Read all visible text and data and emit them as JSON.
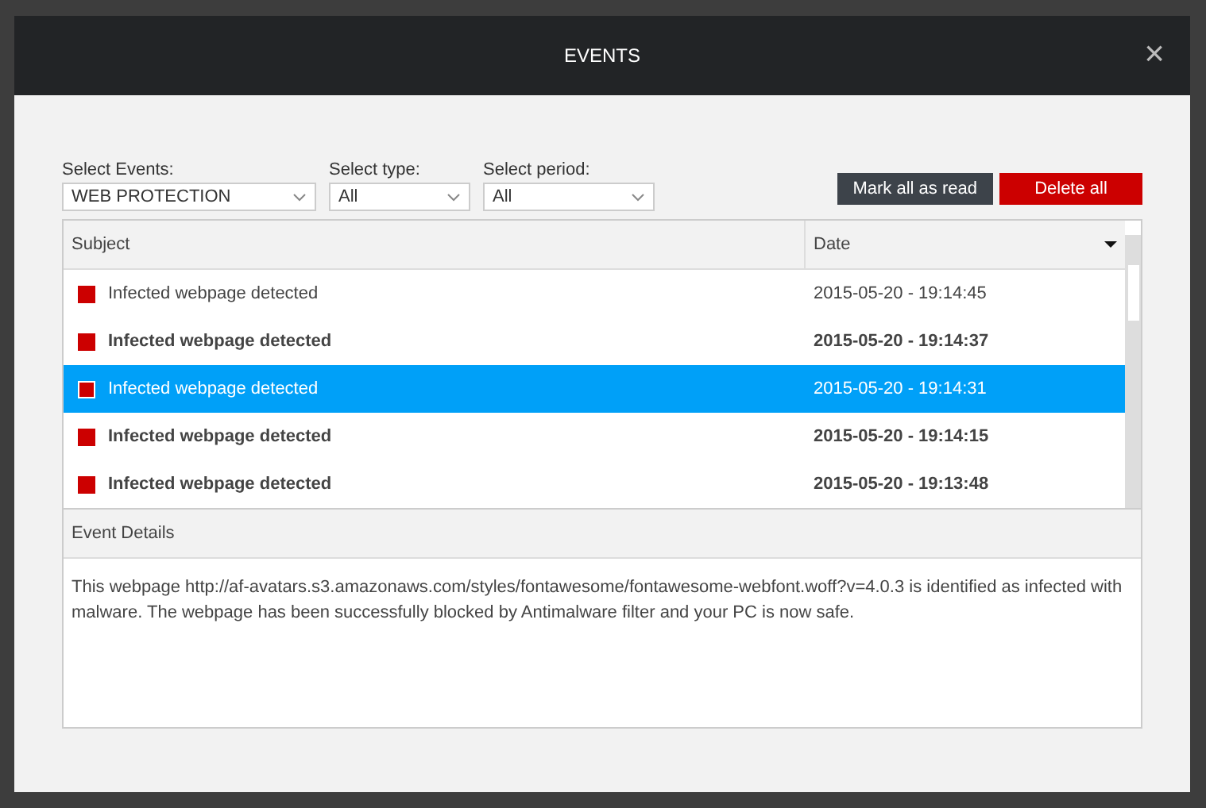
{
  "window": {
    "title": "EVENTS",
    "close": "×"
  },
  "filters": [
    {
      "label": "Select Events:",
      "value": "WEB PROTECTION"
    },
    {
      "label": "Select type:",
      "value": "All"
    },
    {
      "label": "Select period:",
      "value": "All"
    }
  ],
  "actions": [
    {
      "label": "Mark all as read",
      "kind": "secondary"
    },
    {
      "label": "Delete all",
      "kind": "danger"
    }
  ],
  "table": {
    "columns": [
      {
        "label": "Subject",
        "sorted": false
      },
      {
        "label": "Date",
        "sorted": true
      }
    ],
    "rows": [
      {
        "subject": "Infected webpage detected",
        "date": "2015-05-20 - 19:14:45",
        "unread": false,
        "selected": false
      },
      {
        "subject": "Infected webpage detected",
        "date": "2015-05-20 - 19:14:37",
        "unread": true,
        "selected": false
      },
      {
        "subject": "Infected webpage detected",
        "date": "2015-05-20 - 19:14:31",
        "unread": false,
        "selected": true
      },
      {
        "subject": "Infected webpage detected",
        "date": "2015-05-20 - 19:14:15",
        "unread": true,
        "selected": false
      },
      {
        "subject": "Infected webpage detected",
        "date": "2015-05-20 - 19:13:48",
        "unread": true,
        "selected": false
      }
    ]
  },
  "details": {
    "title": "Event Details",
    "text": "This webpage http://af-avatars.s3.amazonaws.com/styles/fontawesome/fontawesome-webfont.woff?v=4.0.3 is identified as infected with malware. The webpage has been successfully blocked by Antimalware filter and your PC is now safe."
  }
}
